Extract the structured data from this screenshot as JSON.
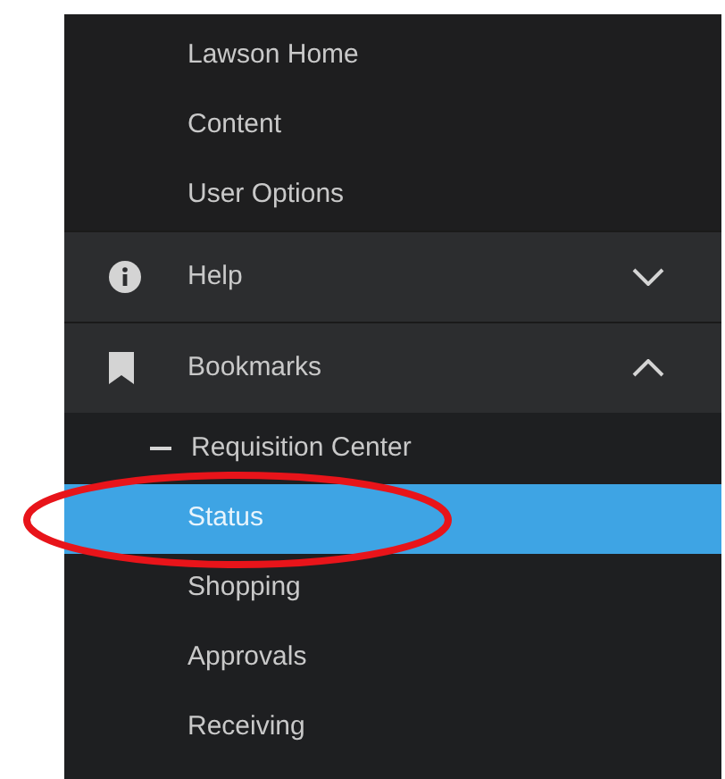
{
  "top_links": [
    {
      "label": "Lawson Home"
    },
    {
      "label": "Content"
    },
    {
      "label": "User Options"
    }
  ],
  "sections": [
    {
      "label": "Help",
      "kind": "info",
      "expanded": false
    },
    {
      "label": "Bookmarks",
      "kind": "bookmark",
      "expanded": true,
      "children": [
        {
          "label": "Requisition Center",
          "expanded": true,
          "children": [
            {
              "label": "Status",
              "selected": true
            },
            {
              "label": "Shopping",
              "selected": false
            },
            {
              "label": "Approvals",
              "selected": false
            },
            {
              "label": "Receiving",
              "selected": false
            }
          ]
        }
      ]
    }
  ],
  "annotations": [
    {
      "kind": "ellipse"
    }
  ]
}
